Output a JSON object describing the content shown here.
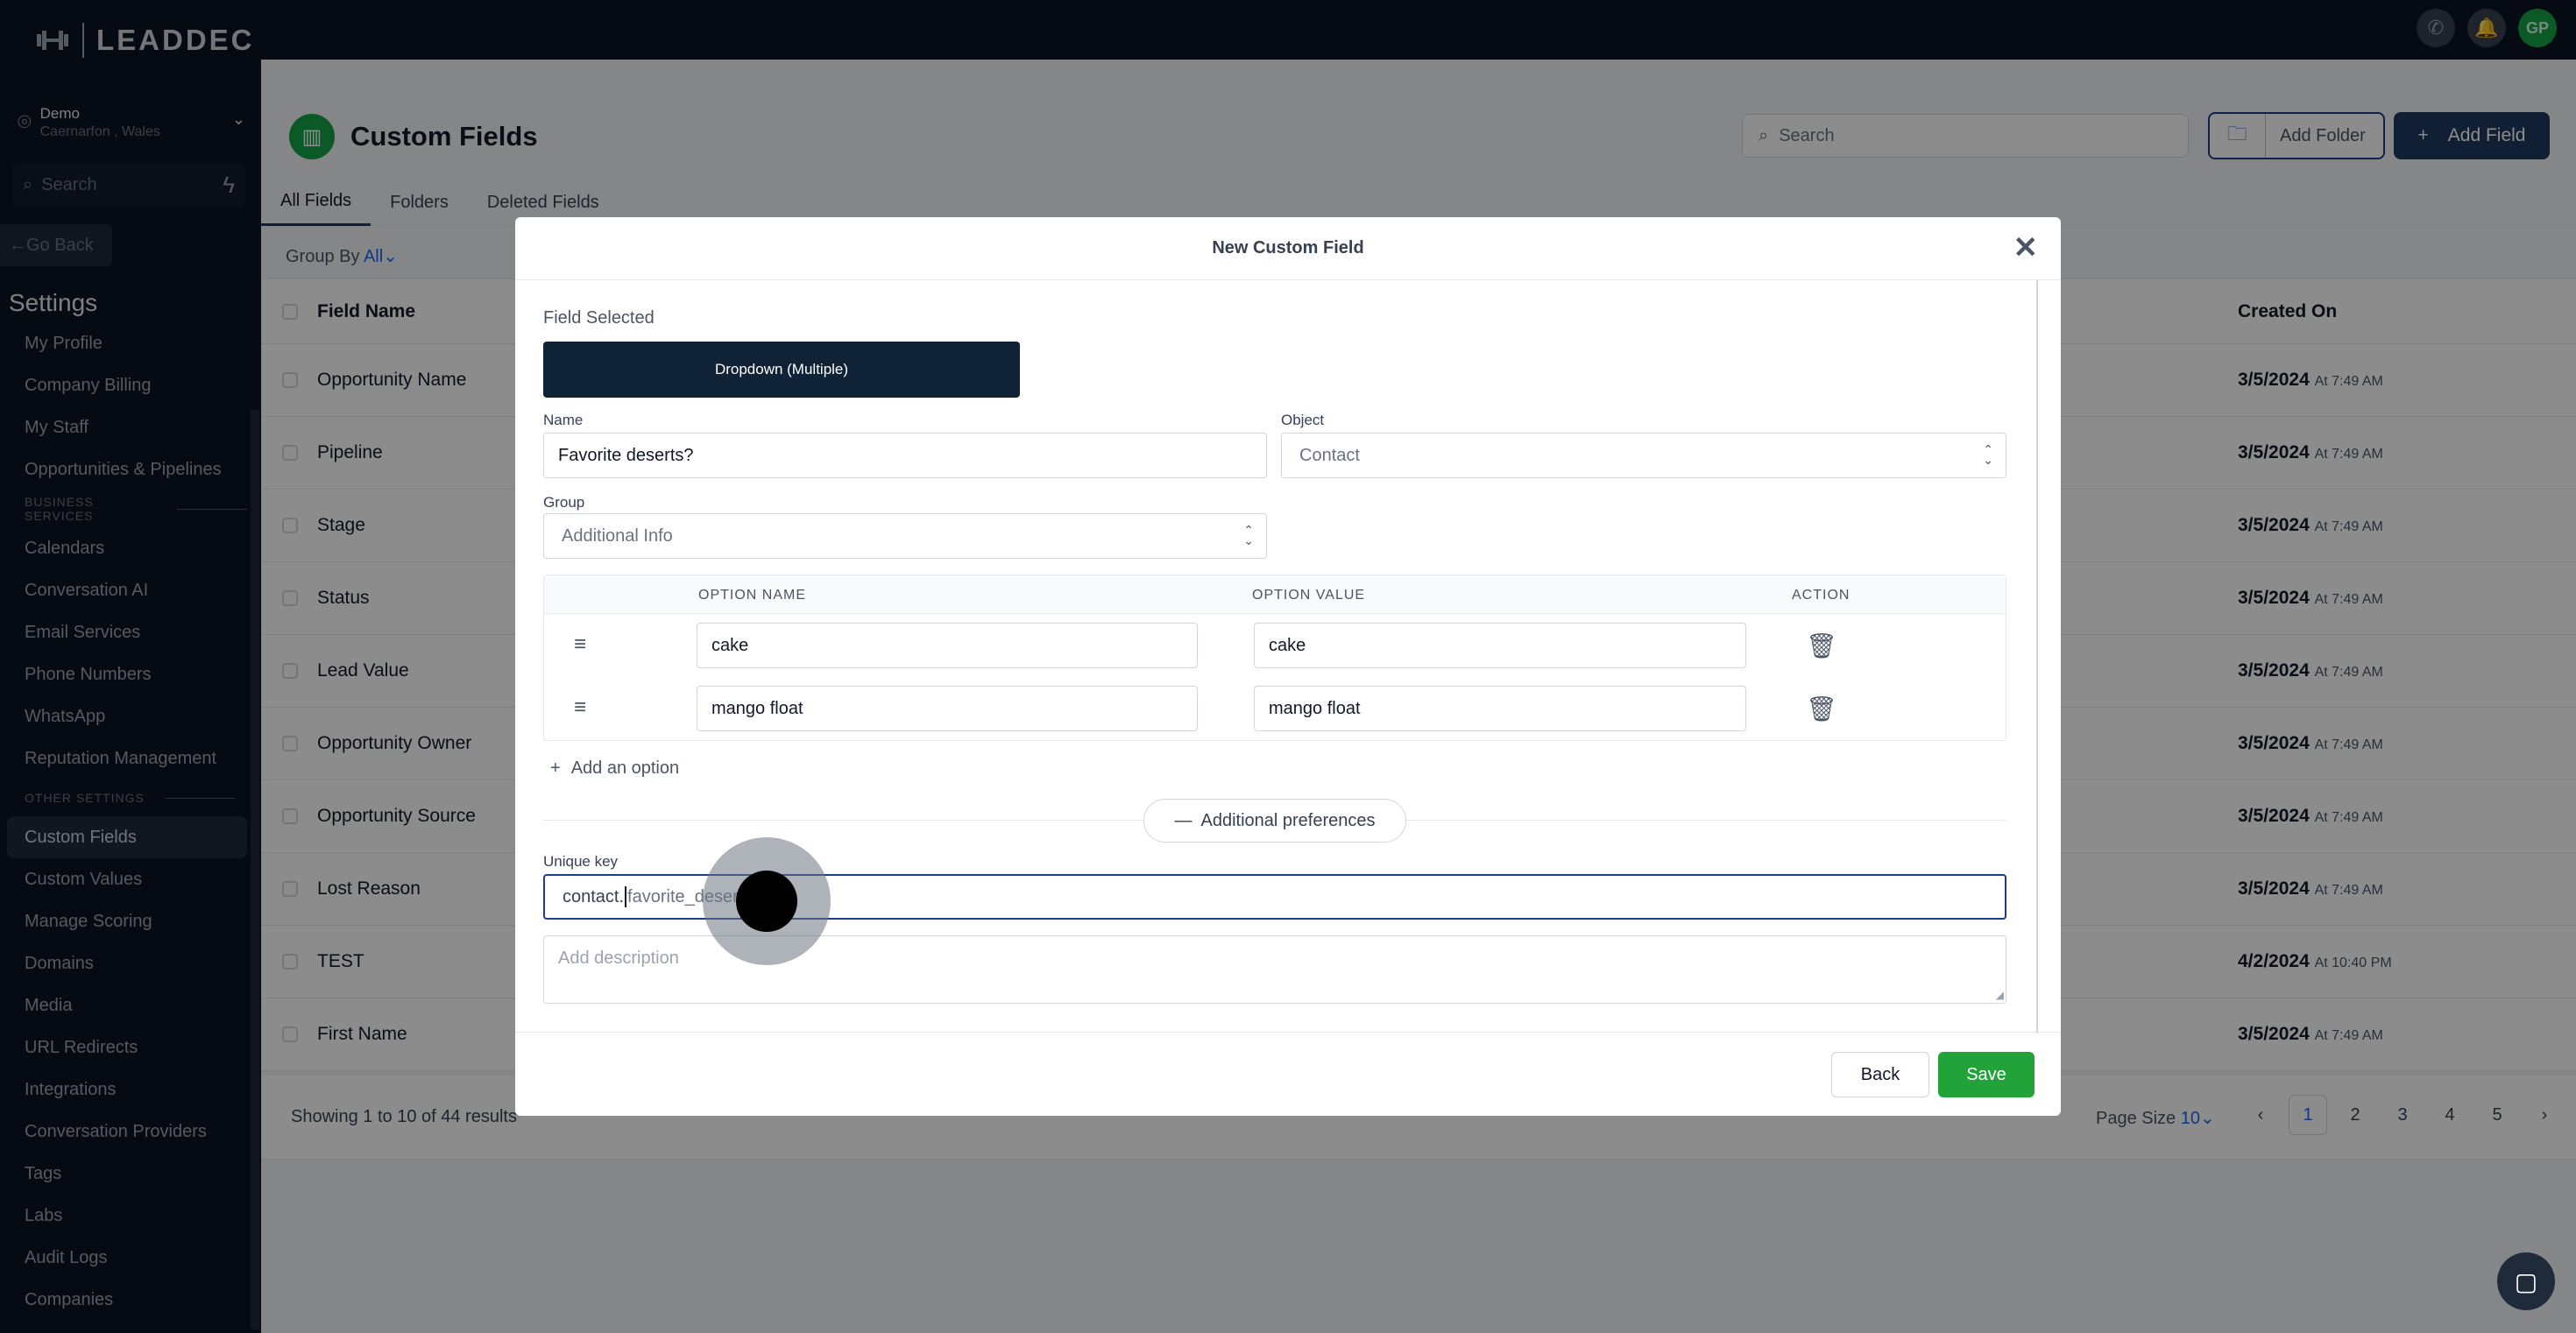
{
  "app": {
    "logo_text": "LEADDEC",
    "avatar_initials": "GP"
  },
  "location": {
    "name": "Demo",
    "sub": "Caernarfon , Wales"
  },
  "sidebar": {
    "search_placeholder": "Search",
    "go_back": "Go Back",
    "settings_title": "Settings",
    "items_top": [
      "My Profile",
      "Company Billing",
      "My Staff",
      "Opportunities & Pipelines"
    ],
    "section_business": "BUSINESS SERVICES",
    "items_business": [
      "Calendars",
      "Conversation AI",
      "Email Services",
      "Phone Numbers",
      "WhatsApp",
      "Reputation Management"
    ],
    "section_other": "OTHER SETTINGS",
    "items_other": [
      "Custom Fields",
      "Custom Values",
      "Manage Scoring",
      "Domains",
      "Media",
      "URL Redirects",
      "Integrations",
      "Conversation Providers",
      "Tags",
      "Labs",
      "Audit Logs",
      "Companies"
    ]
  },
  "page": {
    "title": "Custom Fields",
    "search_placeholder": "Search",
    "add_folder": "Add Folder",
    "add_field": "Add Field",
    "tabs": [
      "All Fields",
      "Folders",
      "Deleted Fields"
    ],
    "group_by_label": "Group By",
    "group_by_value": "All",
    "col_field_name": "Field Name",
    "col_created_on": "Created On",
    "rows": [
      {
        "name": "Opportunity Name",
        "date": "3/5/2024",
        "time": "At 7:49 AM"
      },
      {
        "name": "Pipeline",
        "date": "3/5/2024",
        "time": "At 7:49 AM"
      },
      {
        "name": "Stage",
        "date": "3/5/2024",
        "time": "At 7:49 AM"
      },
      {
        "name": "Status",
        "date": "3/5/2024",
        "time": "At 7:49 AM"
      },
      {
        "name": "Lead Value",
        "date": "3/5/2024",
        "time": "At 7:49 AM"
      },
      {
        "name": "Opportunity Owner",
        "date": "3/5/2024",
        "time": "At 7:49 AM"
      },
      {
        "name": "Opportunity Source",
        "date": "3/5/2024",
        "time": "At 7:49 AM"
      },
      {
        "name": "Lost Reason",
        "date": "3/5/2024",
        "time": "At 7:49 AM"
      },
      {
        "name": "TEST",
        "date": "4/2/2024",
        "time": "At 10:40 PM"
      },
      {
        "name": "First Name",
        "date": "3/5/2024",
        "time": "At 7:49 AM"
      }
    ],
    "showing": "Showing 1 to 10 of 44 results",
    "page_size_label": "Page Size",
    "page_size_value": "10",
    "pages": [
      "1",
      "2",
      "3",
      "4",
      "5"
    ],
    "current_page": "1"
  },
  "modal": {
    "title": "New Custom Field",
    "field_selected_label": "Field Selected",
    "field_type": "Dropdown (Multiple)",
    "name_label": "Name",
    "name_value": "Favorite deserts?",
    "object_label": "Object",
    "object_value": "Contact",
    "group_label": "Group",
    "group_value": "Additional Info",
    "col_option_name": "OPTION NAME",
    "col_option_value": "OPTION VALUE",
    "col_action": "ACTION",
    "options": [
      {
        "name": "cake",
        "value": "cake"
      },
      {
        "name": "mango float",
        "value": "mango float"
      }
    ],
    "add_option": "Add an option",
    "additional_preferences": "Additional preferences",
    "unique_key_label": "Unique key",
    "unique_key_prefix": "contact.",
    "unique_key_rest": "favorite_deserts",
    "description_placeholder": "Add description",
    "back": "Back",
    "save": "Save"
  },
  "colors": {
    "brand_green": "#22a33a",
    "navy": "#0f2236",
    "link_blue": "#2563eb"
  }
}
